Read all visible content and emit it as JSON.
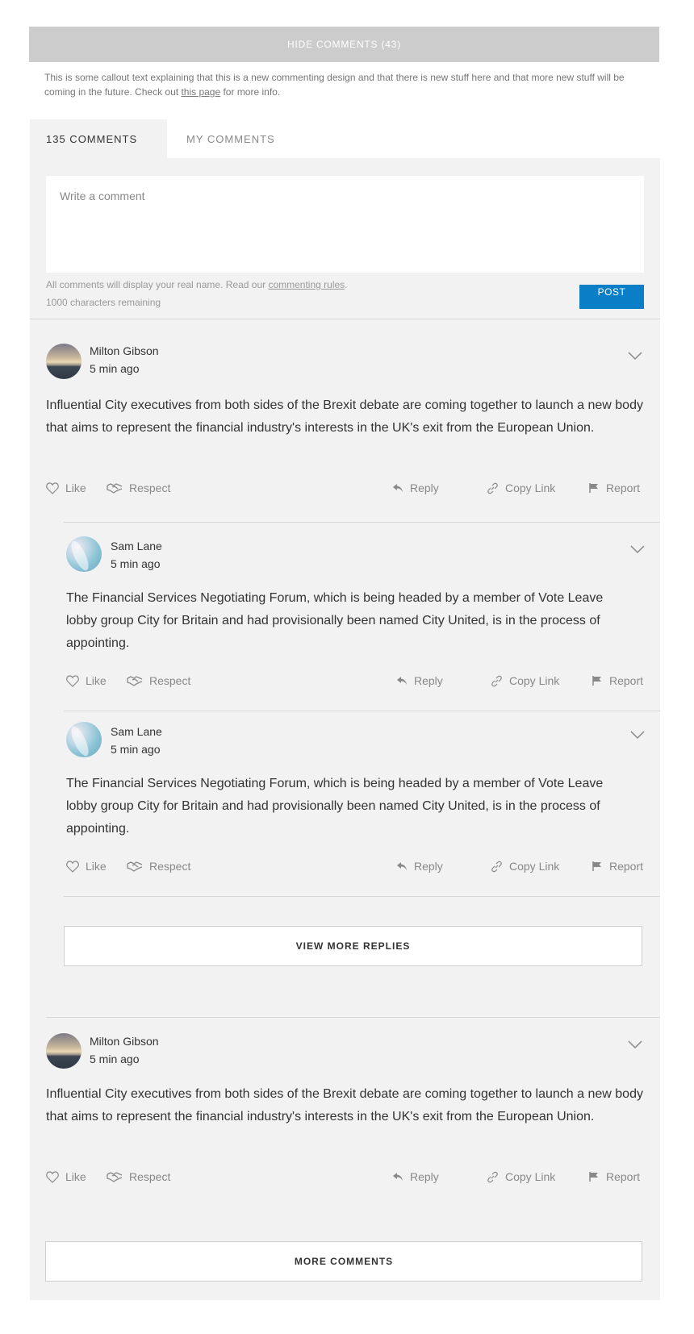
{
  "header": {
    "hide_comments_label": "HIDE COMMENTS (43)"
  },
  "callout": {
    "text_before": "This is some callout text explaining that this is a new commenting design and that there is new stuff here and that more new stuff will be coming in the future. Check out ",
    "link_text": "this page",
    "text_after": " for more info."
  },
  "tabs": [
    {
      "label": "135 COMMENTS",
      "active": true
    },
    {
      "label": "MY COMMENTS",
      "active": false
    }
  ],
  "composer": {
    "placeholder": "Write a comment",
    "rules_before": "All comments will display your real name. Read our ",
    "rules_link": "commenting rules",
    "rules_after": ".",
    "chars_remaining": "1000 characters remaining",
    "post_label": "POST"
  },
  "actions": {
    "like": "Like",
    "respect": "Respect",
    "reply": "Reply",
    "copy_link": "Copy Link",
    "report": "Report"
  },
  "comments": [
    {
      "author": "Milton Gibson",
      "time": "5 min ago",
      "avatar": "mountain-avatar",
      "text": "Influential City executives from both sides of the Brexit debate are coming together to launch a new body that aims to represent the financial industry's interests in the UK's exit from the European Union."
    },
    {
      "author": "Sam Lane",
      "time": "5 min ago",
      "avatar": "feather-avatar",
      "text": "The Financial Services Negotiating Forum, which is being headed by a member of Vote Leave lobby group City for Britain and had provisionally been named City United, is in the process of appointing."
    },
    {
      "author": "Sam Lane",
      "time": "5 min ago",
      "avatar": "feather-avatar",
      "text": "The Financial Services Negotiating Forum, which is being headed by a member of Vote Leave lobby group City for Britain and had provisionally been named City United, is in the process of appointing."
    },
    {
      "author": "Milton Gibson",
      "time": "5 min ago",
      "avatar": "mountain-avatar",
      "text": "Influential City executives from both sides of the Brexit debate are coming together to launch a new body that aims to represent the financial industry's interests in the UK's exit from the European Union."
    }
  ],
  "view_more_replies_label": "VIEW MORE REPLIES",
  "more_comments_label": "MORE COMMENTS",
  "colors": {
    "accent": "#0a7fc8",
    "panel_bg": "#f2f2f2",
    "hide_bar": "#cccccc"
  }
}
